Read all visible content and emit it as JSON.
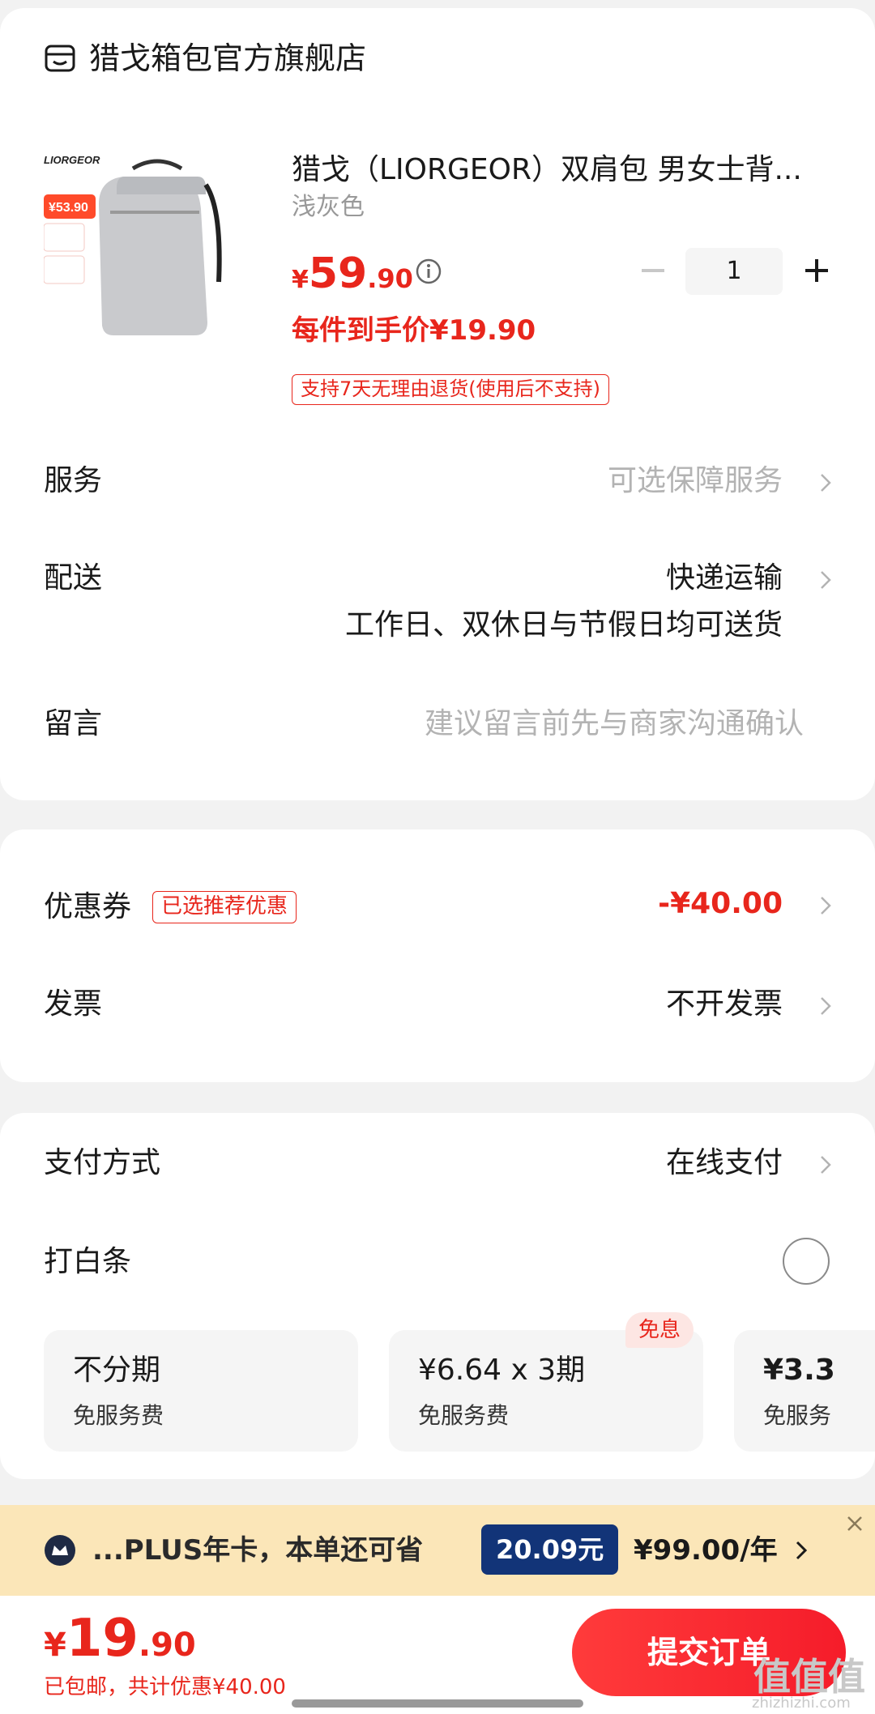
{
  "store": {
    "name": "猎戈箱包官方旗舰店",
    "icon": "store-icon"
  },
  "product": {
    "title": "猎戈（LIORGEOR）双肩包 男女士背...",
    "spec": "浅灰色",
    "thumb_brand": "LIORGEOR",
    "thumb_badge": "¥53.90",
    "price_currency": "¥",
    "price_int": "59",
    "price_dec": ".90",
    "unit_price": "每件到手价¥19.90",
    "return_tag": "支持7天无理由退货(使用后不支持)",
    "quantity": "1"
  },
  "rows": {
    "service_label": "服务",
    "service_value": "可选保障服务",
    "delivery_label": "配送",
    "delivery_value": "快递运输",
    "delivery_note": "工作日、双休日与节假日均可送货",
    "message_label": "留言",
    "message_placeholder": "建议留言前先与商家沟通确认",
    "coupon_label": "优惠券",
    "coupon_tag": "已选推荐优惠",
    "coupon_value": "-¥40.00",
    "invoice_label": "发票",
    "invoice_value": "不开发票",
    "payment_label": "支付方式",
    "payment_value": "在线支付",
    "baitiao_label": "打白条"
  },
  "installments": [
    {
      "title": "不分期",
      "sub": "免服务费"
    },
    {
      "title": "¥6.64 x 3期",
      "sub": "免服务费",
      "tag": "免息"
    },
    {
      "title": "¥3.3",
      "sub": "免服务"
    }
  ],
  "plus": {
    "text": "...PLUS年卡，本单还可省",
    "save": "20.09元",
    "price": "¥99.00/年"
  },
  "footer": {
    "total_currency": "¥",
    "total_int": "19",
    "total_dec": ".90",
    "shipping": "已包邮，共计优惠¥40.00",
    "submit": "提交订单"
  },
  "watermark": {
    "main": "值值值",
    "sub": "zhizhizhi.com"
  },
  "colors": {
    "accent": "#e8261c",
    "plus_bg": "#fbe6b8",
    "plus_tag": "#123478"
  }
}
